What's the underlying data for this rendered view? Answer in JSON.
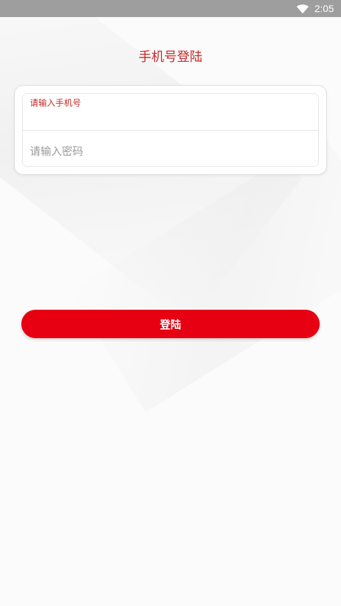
{
  "status_bar": {
    "time": "2:05",
    "icons": [
      "wifi-icon"
    ]
  },
  "page": {
    "title": "手机号登陆"
  },
  "form": {
    "phone": {
      "label": "请输入手机号",
      "value": "",
      "placeholder": ""
    },
    "password": {
      "value": "",
      "placeholder": "请输入密码"
    }
  },
  "actions": {
    "login_label": "登陆"
  },
  "colors": {
    "accent": "#e60012",
    "title_red": "#c62828",
    "status_bar": "#9e9e9e"
  }
}
